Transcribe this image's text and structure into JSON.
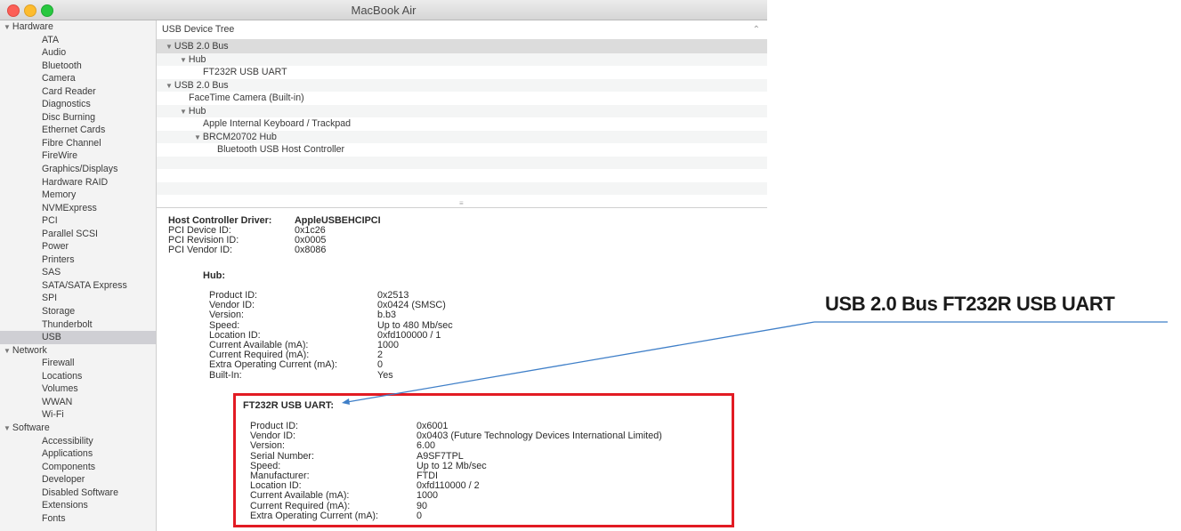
{
  "window": {
    "title": "MacBook Air",
    "traffic_lights": {
      "close": "#fc5f57",
      "minimize": "#fdbc2e",
      "zoom": "#28c840"
    }
  },
  "sidebar": {
    "groups": [
      {
        "label": "Hardware",
        "items": [
          "ATA",
          "Audio",
          "Bluetooth",
          "Camera",
          "Card Reader",
          "Diagnostics",
          "Disc Burning",
          "Ethernet Cards",
          "Fibre Channel",
          "FireWire",
          "Graphics/Displays",
          "Hardware RAID",
          "Memory",
          "NVMExpress",
          "PCI",
          "Parallel SCSI",
          "Power",
          "Printers",
          "SAS",
          "SATA/SATA Express",
          "SPI",
          "Storage",
          "Thunderbolt",
          "USB"
        ]
      },
      {
        "label": "Network",
        "items": [
          "Firewall",
          "Locations",
          "Volumes",
          "WWAN",
          "Wi-Fi"
        ]
      },
      {
        "label": "Software",
        "items": [
          "Accessibility",
          "Applications",
          "Components",
          "Developer",
          "Disabled Software",
          "Extensions",
          "Fonts"
        ]
      }
    ],
    "selected": "USB"
  },
  "tree": {
    "header": "USB Device Tree",
    "rows": [
      {
        "label": "USB 2.0 Bus",
        "indent": 0,
        "expanded": true,
        "selected": true
      },
      {
        "label": "Hub",
        "indent": 1,
        "expanded": true
      },
      {
        "label": "FT232R USB UART",
        "indent": 2
      },
      {
        "label": "USB 2.0 Bus",
        "indent": 0,
        "expanded": true
      },
      {
        "label": "FaceTime Camera (Built-in)",
        "indent": 1
      },
      {
        "label": "Hub",
        "indent": 1,
        "expanded": true
      },
      {
        "label": "Apple Internal Keyboard / Trackpad",
        "indent": 2
      },
      {
        "label": "BRCM20702 Hub",
        "indent": 2,
        "expanded": true
      },
      {
        "label": "Bluetooth USB Host Controller",
        "indent": 3
      }
    ]
  },
  "details": {
    "controller": [
      {
        "key": "Host Controller Driver:",
        "value": "AppleUSBEHCIPCI",
        "bold": true
      },
      {
        "key": "PCI Device ID:",
        "value": "0x1c26"
      },
      {
        "key": "PCI Revision ID:",
        "value": "0x0005"
      },
      {
        "key": "PCI Vendor ID:",
        "value": "0x8086"
      }
    ],
    "hub": {
      "title": "Hub:",
      "fields": [
        {
          "key": "Product ID:",
          "value": "0x2513"
        },
        {
          "key": "Vendor ID:",
          "value": "0x0424  (SMSC)"
        },
        {
          "key": "Version:",
          "value": "b.b3"
        },
        {
          "key": "Speed:",
          "value": "Up to 480 Mb/sec"
        },
        {
          "key": "Location ID:",
          "value": "0xfd100000 / 1"
        },
        {
          "key": "Current Available (mA):",
          "value": "1000"
        },
        {
          "key": "Current Required (mA):",
          "value": "2"
        },
        {
          "key": "Extra Operating Current (mA):",
          "value": "0"
        },
        {
          "key": "Built-In:",
          "value": "Yes"
        }
      ]
    },
    "ft232r": {
      "title": "FT232R USB UART:",
      "fields": [
        {
          "key": "Product ID:",
          "value": "0x6001"
        },
        {
          "key": "Vendor ID:",
          "value": "0x0403  (Future Technology Devices International Limited)"
        },
        {
          "key": "Version:",
          "value": "6.00"
        },
        {
          "key": "Serial Number:",
          "value": "A9SF7TPL"
        },
        {
          "key": "Speed:",
          "value": "Up to 12 Mb/sec"
        },
        {
          "key": "Manufacturer:",
          "value": "FTDI"
        },
        {
          "key": "Location ID:",
          "value": "0xfd110000 / 2"
        },
        {
          "key": "Current Available (mA):",
          "value": "1000"
        },
        {
          "key": "Current Required (mA):",
          "value": "90"
        },
        {
          "key": "Extra Operating Current (mA):",
          "value": "0"
        }
      ]
    }
  },
  "annotation": {
    "text": "USB 2.0 Bus FT232R USB UART",
    "highlight_color": "#e21b23",
    "line_color": "#3f7fc8"
  }
}
